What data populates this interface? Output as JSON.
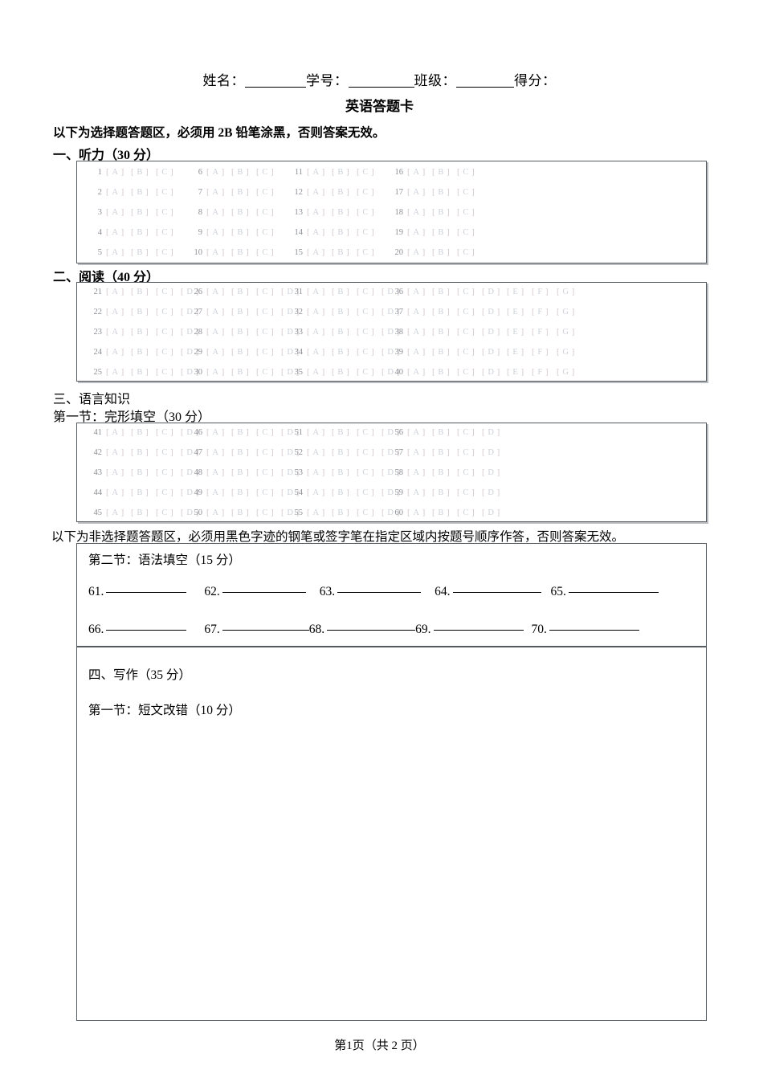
{
  "header": {
    "name_label": "姓名：",
    "student_id_label": "学号：",
    "class_label": "班级：",
    "score_label": "得分：",
    "title": "英语答题卡"
  },
  "notices": {
    "choice": "以下为选择题答题区，必须用 2B 铅笔涂黑，否则答案无效。",
    "non_choice": "以下为非选择题答题区，必须用黑色字迹的钢笔或签字笔在指定区域内按题号顺序作答，否则答案无效。"
  },
  "sections": {
    "listening_heading": "一、听力（30 分）",
    "reading_heading": "二、阅读（40 分）",
    "language_heading": "三、语言知识",
    "cloze_heading": "第一节：完形填空（30 分）",
    "grammar_heading": "第二节：语法填空（15 分）",
    "writing_heading": "四、写作（35 分）",
    "writing_sub_heading": "第一节：短文改错（10 分）"
  },
  "answer_grids": {
    "listening": {
      "columns": [
        {
          "questions": [
            1,
            2,
            3,
            4,
            5
          ],
          "options": [
            "A",
            "B",
            "C"
          ]
        },
        {
          "questions": [
            6,
            7,
            8,
            9,
            10
          ],
          "options": [
            "A",
            "B",
            "C"
          ]
        },
        {
          "questions": [
            11,
            12,
            13,
            14,
            15
          ],
          "options": [
            "A",
            "B",
            "C"
          ]
        },
        {
          "questions": [
            16,
            17,
            18,
            19,
            20
          ],
          "options": [
            "A",
            "B",
            "C"
          ]
        }
      ]
    },
    "reading": {
      "columns": [
        {
          "questions": [
            21,
            22,
            23,
            24,
            25
          ],
          "options": [
            "A",
            "B",
            "C",
            "D"
          ]
        },
        {
          "questions": [
            26,
            27,
            28,
            29,
            30
          ],
          "options": [
            "A",
            "B",
            "C",
            "D"
          ]
        },
        {
          "questions": [
            31,
            32,
            33,
            34,
            35
          ],
          "options": [
            "A",
            "B",
            "C",
            "D"
          ]
        },
        {
          "questions": [
            36,
            37,
            38,
            39,
            40
          ],
          "options": [
            "A",
            "B",
            "C",
            "D",
            "E",
            "F",
            "G"
          ]
        }
      ]
    },
    "cloze": {
      "columns": [
        {
          "questions": [
            41,
            42,
            43,
            44,
            45
          ],
          "options": [
            "A",
            "B",
            "C",
            "D"
          ]
        },
        {
          "questions": [
            46,
            47,
            48,
            49,
            50
          ],
          "options": [
            "A",
            "B",
            "C",
            "D"
          ]
        },
        {
          "questions": [
            51,
            52,
            53,
            54,
            55
          ],
          "options": [
            "A",
            "B",
            "C",
            "D"
          ]
        },
        {
          "questions": [
            56,
            57,
            58,
            59,
            60
          ],
          "options": [
            "A",
            "B",
            "C",
            "D"
          ]
        }
      ]
    }
  },
  "grammar_fill": {
    "row1": [
      61,
      62,
      63,
      64,
      65
    ],
    "row2": [
      66,
      67,
      68,
      69,
      70
    ]
  },
  "footer": {
    "page_text": "第1页（共 2 页）"
  },
  "colors": {
    "bubble_text": "#ccd0d8",
    "question_number": "#8d9096",
    "box_border": "#555a5e",
    "box_shadow": "#b8bcc0"
  }
}
